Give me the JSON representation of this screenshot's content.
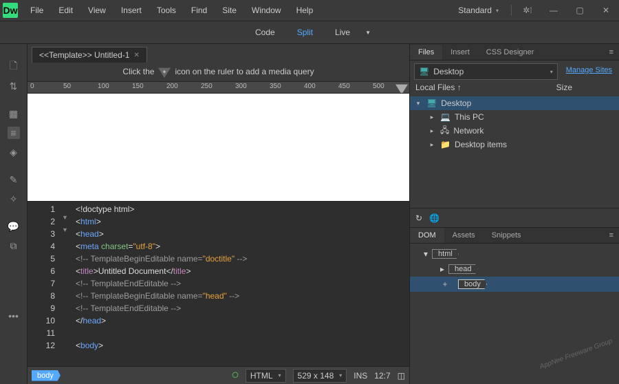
{
  "app": {
    "logo_text": "Dw"
  },
  "menu": [
    "File",
    "Edit",
    "View",
    "Insert",
    "Tools",
    "Find",
    "Site",
    "Window",
    "Help"
  ],
  "workspace": "Standard",
  "viewmodes": {
    "code": "Code",
    "split": "Split",
    "live": "Live"
  },
  "tab": {
    "title": "<<Template>> Untitled-1"
  },
  "hint": {
    "before": "Click the",
    "after": "icon on the ruler to add a media query"
  },
  "ruler_ticks": [
    "0",
    "50",
    "100",
    "150",
    "200",
    "250",
    "300",
    "350",
    "400",
    "450",
    "500"
  ],
  "code_lines": [
    "1",
    "2",
    "3",
    "4",
    "5",
    "6",
    "7",
    "8",
    "9",
    "10",
    "11",
    "12"
  ],
  "source": {
    "l1": {
      "a": "<!doctype html>"
    },
    "l2": {
      "a": "<",
      "b": "html",
      "c": ">"
    },
    "l3": {
      "a": "<",
      "b": "head",
      "c": ">"
    },
    "l4": {
      "a": "<",
      "b": "meta",
      "c": " ",
      "d": "charset",
      "e": "=",
      "f": "\"utf-8\"",
      "g": ">"
    },
    "l5": {
      "a": "<!-- TemplateBeginEditable name=",
      "b": "\"doctitle\"",
      "c": " -->"
    },
    "l6": {
      "a": "<",
      "b": "title",
      "c": ">",
      "d": "Untitled Document",
      "e": "</",
      "f": "title",
      "g": ">"
    },
    "l7": {
      "a": "<!-- TemplateEndEditable -->"
    },
    "l8": {
      "a": "<!-- TemplateBeginEditable name=",
      "b": "\"head\"",
      "c": " -->"
    },
    "l9": {
      "a": "<!-- TemplateEndEditable -->"
    },
    "l10": {
      "a": "</",
      "b": "head",
      "c": ">"
    },
    "l12": {
      "a": "<",
      "b": "body",
      "c": ">"
    }
  },
  "status": {
    "tag": "body",
    "lang": "HTML",
    "dims": "529 x 148",
    "mode": "INS",
    "pos": "12:7"
  },
  "panels": {
    "files": {
      "tabs": [
        "Files",
        "Insert",
        "CSS Designer"
      ],
      "drive": "Desktop",
      "manage": "Manage Sites",
      "col1": "Local Files ",
      "col2": "Size",
      "tree": [
        {
          "label": "Desktop",
          "ico": "desktop",
          "sel": true,
          "depth": 0,
          "exp": "▾"
        },
        {
          "label": "This PC",
          "ico": "pc",
          "depth": 1,
          "exp": "▸"
        },
        {
          "label": "Network",
          "ico": "net",
          "depth": 1,
          "exp": "▸"
        },
        {
          "label": "Desktop items",
          "ico": "folder",
          "depth": 1,
          "exp": "▸"
        }
      ]
    },
    "dom": {
      "tabs": [
        "DOM",
        "Assets",
        "Snippets"
      ],
      "rows": [
        {
          "tag": "html",
          "depth": 0,
          "exp": "▾"
        },
        {
          "tag": "head",
          "depth": 1,
          "exp": "▸"
        },
        {
          "tag": "body",
          "depth": 1,
          "exp": "",
          "sel": true,
          "plus": true
        }
      ]
    }
  },
  "watermark": "AppNee Freeware Group"
}
